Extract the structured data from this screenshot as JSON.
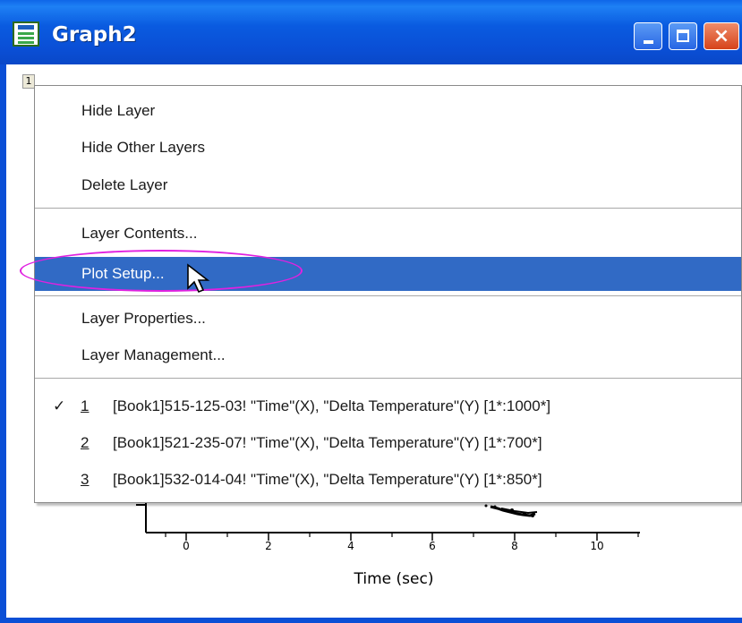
{
  "window": {
    "title": "Graph2",
    "close_glyph": "×"
  },
  "layer": {
    "tag": "1"
  },
  "plot": {
    "x_ticks": [
      "0",
      "2",
      "4",
      "6",
      "8",
      "10"
    ],
    "x_axis_title": "Time (sec)"
  },
  "context_menu": {
    "items": [
      {
        "label": "Hide Layer"
      },
      {
        "label": "Hide Other Layers"
      },
      {
        "label": "Delete Layer"
      },
      {
        "label": "Layer Contents..."
      },
      {
        "label": "Plot Setup...",
        "highlighted": true
      },
      {
        "label": "Layer Properties..."
      },
      {
        "label": "Layer Management..."
      }
    ],
    "plots": [
      {
        "checked": true,
        "index": "1",
        "label": "[Book1]515-125-03! \"Time\"(X), \"Delta Temperature\"(Y) [1*:1000*]"
      },
      {
        "checked": false,
        "index": "2",
        "label": "[Book1]521-235-07! \"Time\"(X), \"Delta Temperature\"(Y) [1*:700*]"
      },
      {
        "checked": false,
        "index": "3",
        "label": "[Book1]532-014-04! \"Time\"(X), \"Delta Temperature\"(Y) [1*:850*]"
      }
    ],
    "check_glyph": "✓"
  },
  "colors": {
    "titlebar": "#0a4fd6",
    "menu_highlight": "#316ac5",
    "annotation_ellipse": "#e021e0"
  }
}
